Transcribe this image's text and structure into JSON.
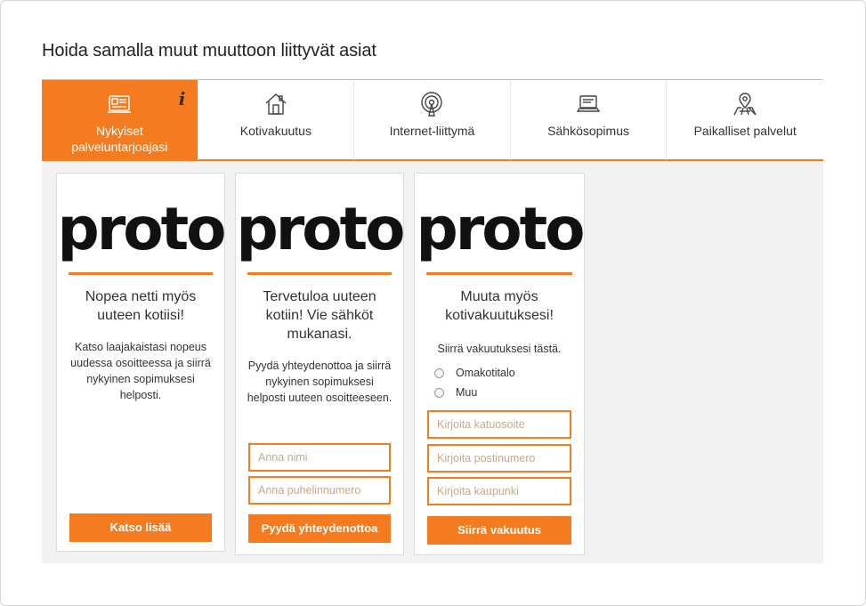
{
  "heading": "Hoida samalla muut muuttoon liittyvät asiat",
  "tabs": [
    {
      "label": "Nykyiset palveluntarjoajasi",
      "icon": "id-card-icon",
      "active": true
    },
    {
      "label": "Kotivakuutus",
      "icon": "house-icon",
      "active": false
    },
    {
      "label": "Internet-liittymä",
      "icon": "antenna-icon",
      "active": false
    },
    {
      "label": "Sähkösopimus",
      "icon": "laptop-icon",
      "active": false
    },
    {
      "label": "Paikalliset palvelut",
      "icon": "map-pin-icon",
      "active": false
    }
  ],
  "info_icon": "i",
  "colors": {
    "accent": "#f47b20",
    "panel_bg": "#f2f2f2"
  },
  "cards": [
    {
      "logo": "proto",
      "title": "Nopea netti myös uuteen kotiisi!",
      "text": "Katso laajakaistasi nopeus uudessa osoitteessa ja siirrä nykyinen sopimuksesi helposti.",
      "button": "Katso lisää"
    },
    {
      "logo": "proto",
      "title": "Tervetuloa uuteen kotiin! Vie sähköt mukanasi.",
      "text": "Pyydä yhteydenottoa ja siirrä nykyinen sopimuksesi helposti uuteen osoitteeseen.",
      "fields": [
        {
          "placeholder": "Anna nimi",
          "value": ""
        },
        {
          "placeholder": "Anna puhelinnumero",
          "value": ""
        }
      ],
      "button": "Pyydä yhteydenottoa"
    },
    {
      "logo": "proto",
      "title": "Muuta myös kotivakuutuksesi!",
      "text": "Siirrä vakuutuksesi tästä.",
      "radios": [
        {
          "label": "Omakotitalo",
          "checked": false
        },
        {
          "label": "Muu",
          "checked": false
        }
      ],
      "fields": [
        {
          "placeholder": "Kirjoita katuosoite",
          "value": ""
        },
        {
          "placeholder": "Kirjoita postinumero",
          "value": ""
        },
        {
          "placeholder": "Kirjoita kaupunki",
          "value": ""
        }
      ],
      "button": "Siirrä vakuutus"
    }
  ]
}
